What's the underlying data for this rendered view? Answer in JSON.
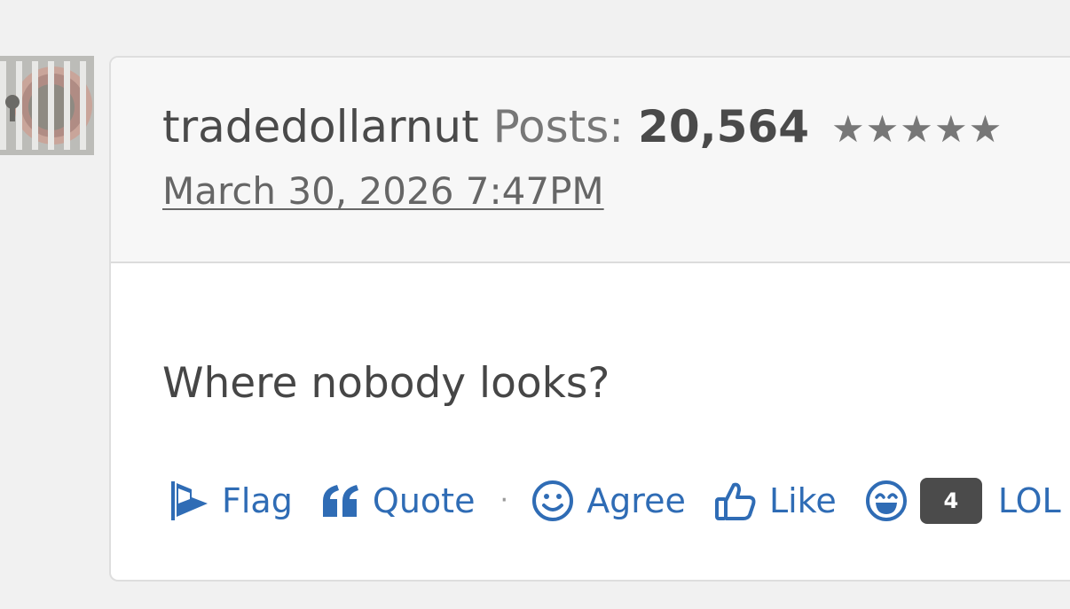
{
  "post": {
    "author": "tradedollarnut",
    "posts_label": "Posts:",
    "posts_count": "20,564",
    "rank_stars": "★★★★★",
    "date": "March 30, 2026 7:47PM",
    "body": "Where nobody looks?"
  },
  "actions": {
    "flag": "Flag",
    "quote": "Quote",
    "separator": "·",
    "agree": "Agree",
    "like": "Like",
    "lol_count": "4",
    "lol": "LOL"
  },
  "icons": {
    "flag": "flag-icon",
    "quote": "quote-icon",
    "agree": "smiley-icon",
    "like": "thumbs-up-icon",
    "lol": "laughing-face-icon"
  },
  "colors": {
    "link": "#2f6cb5",
    "text": "#464646",
    "badge": "#4b4b4b",
    "header_bg": "#f7f7f7",
    "page_bg": "#f1f1f1"
  }
}
